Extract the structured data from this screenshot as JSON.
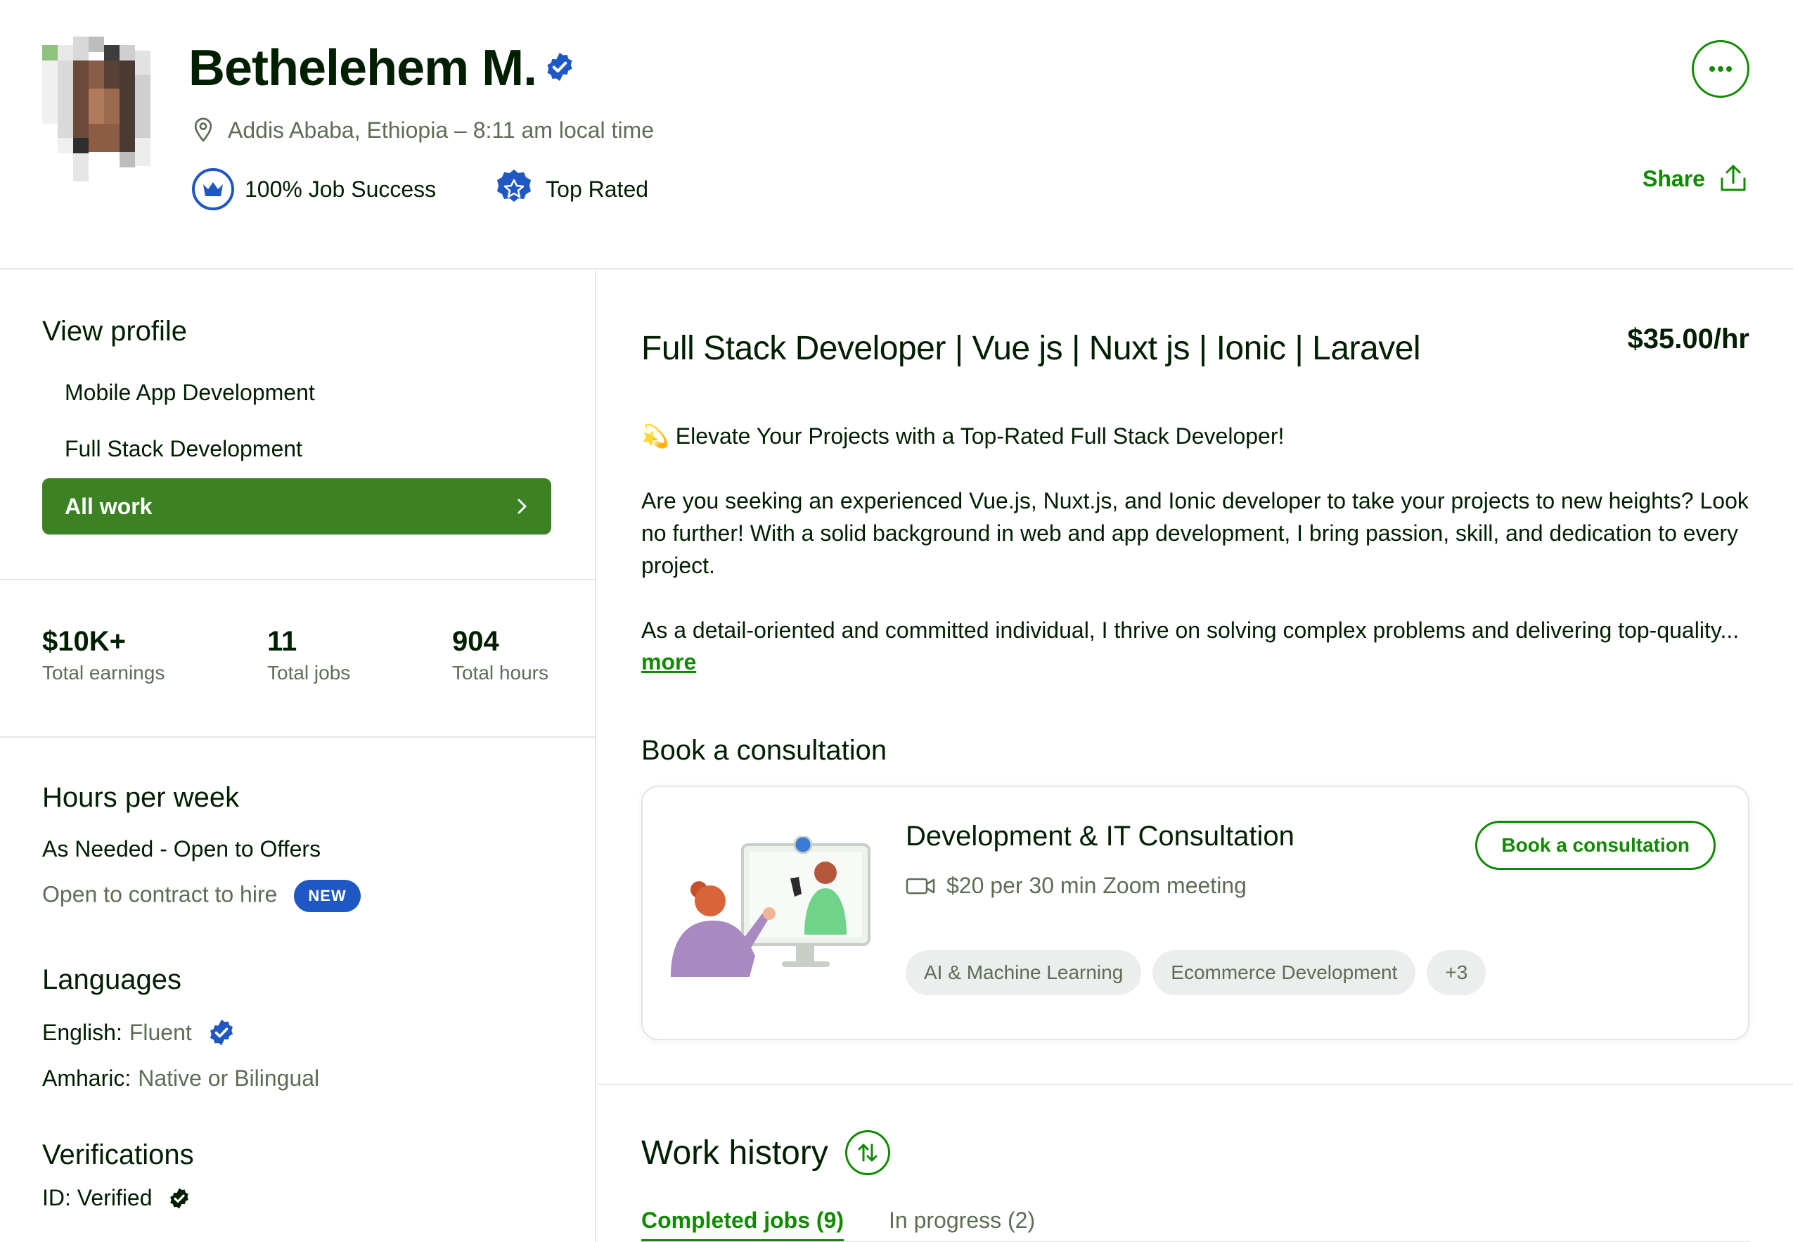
{
  "profile": {
    "name": "Bethelehem M.",
    "location": "Addis Ababa, Ethiopia – 8:11 am local time",
    "job_success": "100% Job Success",
    "top_rated": "Top Rated",
    "share_label": "Share"
  },
  "sidebar": {
    "view_profile_title": "View profile",
    "profile_links": [
      "Mobile App Development",
      "Full Stack Development"
    ],
    "all_work_label": "All work",
    "stats": [
      {
        "value": "$10K+",
        "label": "Total earnings"
      },
      {
        "value": "11",
        "label": "Total jobs"
      },
      {
        "value": "904",
        "label": "Total hours"
      }
    ],
    "hours_title": "Hours per week",
    "hours_value": "As Needed - Open to Offers",
    "contract_text": "Open to contract to hire",
    "new_tag": "NEW",
    "languages_title": "Languages",
    "languages": [
      {
        "name": "English:",
        "level": "Fluent"
      },
      {
        "name": "Amharic:",
        "level": "Native or Bilingual"
      }
    ],
    "verifications_title": "Verifications",
    "id_verified": "ID: Verified"
  },
  "main": {
    "job_title": "Full Stack Developer | Vue js | Nuxt js | Ionic | Laravel",
    "rate": "$35.00/hr",
    "overview": [
      "💫 Elevate Your Projects with a Top-Rated Full Stack Developer!",
      "Are you seeking an experienced Vue.js, Nuxt.js, and Ionic developer to take your projects to new heights? Look no further! With a solid background in web and app development, I bring passion, skill, and dedication to every project.",
      "As a detail-oriented and committed individual, I thrive on solving complex problems and delivering top-quality..."
    ],
    "more_label": "more",
    "consultation_title": "Book a consultation",
    "consultation": {
      "title": "Development & IT Consultation",
      "meta": "$20 per 30 min Zoom meeting",
      "book_label": "Book a consultation",
      "tags": [
        "AI & Machine Learning",
        "Ecommerce Development",
        "+3"
      ]
    },
    "work_history_title": "Work history",
    "tabs": [
      "Completed jobs (9)",
      "In progress (2)"
    ]
  },
  "colors": {
    "brand_green": "#108a00",
    "button_green": "#3c8224",
    "verified_blue": "#1f57c3"
  }
}
